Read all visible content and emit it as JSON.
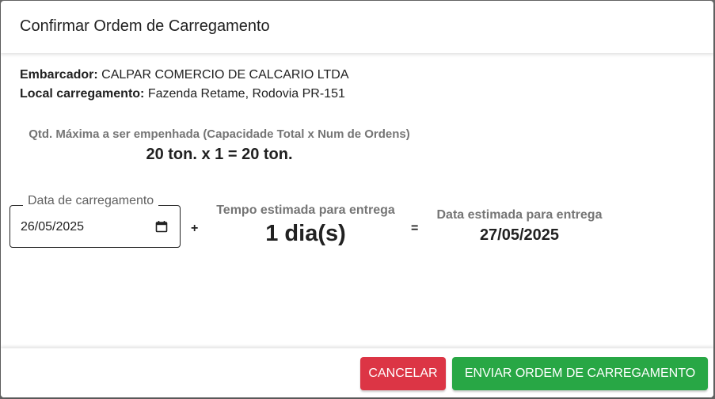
{
  "dialog": {
    "title": "Confirmar Ordem de Carregamento"
  },
  "shipper": {
    "label": "Embarcador:",
    "value": "CALPAR COMERCIO DE CALCARIO LTDA"
  },
  "location": {
    "label": "Local carregamento:",
    "value": "Fazenda Retame, Rodovia PR-151"
  },
  "capacity": {
    "label": "Qtd. Máxima a ser empenhada (Capacidade Total x Num de Ordens)",
    "value": "20 ton. x 1 = 20 ton."
  },
  "loading_date": {
    "label": "Data de carregamento",
    "value": "26/05/2025",
    "icon": "calendar-icon"
  },
  "operators": {
    "plus": "+",
    "equals": "="
  },
  "delivery_time": {
    "label": "Tempo estimada para entrega",
    "value": "1 dia(s)"
  },
  "delivery_date": {
    "label": "Data estimada para entrega",
    "value": "27/05/2025"
  },
  "footer": {
    "cancel_label": "CANCELAR",
    "send_label": "ENVIAR ORDEM DE CARREGAMENTO"
  },
  "colors": {
    "cancel": "#dc3545",
    "send": "#28a745"
  }
}
